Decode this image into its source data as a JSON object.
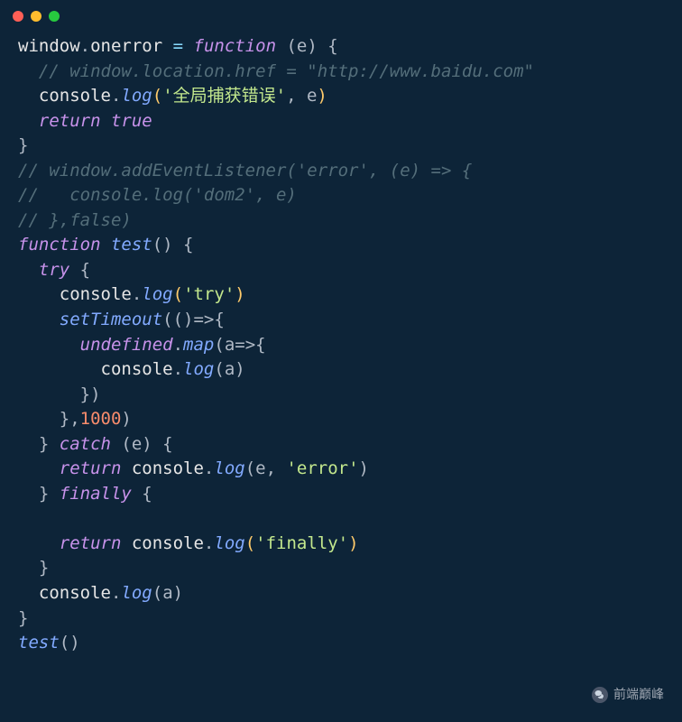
{
  "code": {
    "line1": {
      "t1": "window",
      "t2": ".",
      "t3": "onerror",
      "t4": " = ",
      "t5": "function",
      "t6": " (e) {"
    },
    "line2": "  // window.location.href = \"http://www.baidu.com\"",
    "line3": {
      "indent": "  ",
      "t1": "console",
      "t2": ".",
      "t3": "log",
      "t4": "(",
      "t5": "'全局捕获错误'",
      "t6": ", e",
      "t7": ")"
    },
    "line4": {
      "indent": "  ",
      "t1": "return",
      "t2": " ",
      "t3": "true"
    },
    "line5": "}",
    "line6": "// window.addEventListener('error', (e) => {",
    "line7": "//   console.log('dom2', e)",
    "line8": "// },false)",
    "line9": {
      "t1": "function",
      "t2": " ",
      "t3": "test",
      "t4": "() {"
    },
    "line10": {
      "indent": "  ",
      "t1": "try",
      "t2": " {"
    },
    "line11": {
      "indent": "    ",
      "t1": "console",
      "t2": ".",
      "t3": "log",
      "t4": "(",
      "t5": "'try'",
      "t6": ")"
    },
    "line12": {
      "indent": "    ",
      "t1": "setTimeout",
      "t2": "(()=>{"
    },
    "line13": {
      "indent": "      ",
      "t1": "undefined",
      "t2": ".",
      "t3": "map",
      "t4": "(a=>{"
    },
    "line14": {
      "indent": "        ",
      "t1": "console",
      "t2": ".",
      "t3": "log",
      "t4": "(a)"
    },
    "line15": {
      "indent": "      ",
      "t1": "})"
    },
    "line16": {
      "indent": "    ",
      "t1": "},",
      "t2": "1000",
      "t3": ")"
    },
    "line17": {
      "indent": "  ",
      "t1": "} ",
      "t2": "catch",
      "t3": " (e) {"
    },
    "line18": {
      "indent": "    ",
      "t1": "return",
      "t2": " console",
      "t3": ".",
      "t4": "log",
      "t5": "(e, ",
      "t6": "'error'",
      "t7": ")"
    },
    "line19": {
      "indent": "  ",
      "t1": "} ",
      "t2": "finally",
      "t3": " {"
    },
    "line20": "",
    "line21": {
      "indent": "    ",
      "t1": "return",
      "t2": " console",
      "t3": ".",
      "t4": "log",
      "t5": "(",
      "t6": "'finally'",
      "t7": ")"
    },
    "line22": {
      "indent": "  ",
      "t1": "}"
    },
    "line23": {
      "indent": "  ",
      "t1": "console",
      "t2": ".",
      "t3": "log",
      "t4": "(a)"
    },
    "line24": "}",
    "line25": {
      "t1": "test",
      "t2": "()"
    }
  },
  "watermark": "前端巅峰"
}
